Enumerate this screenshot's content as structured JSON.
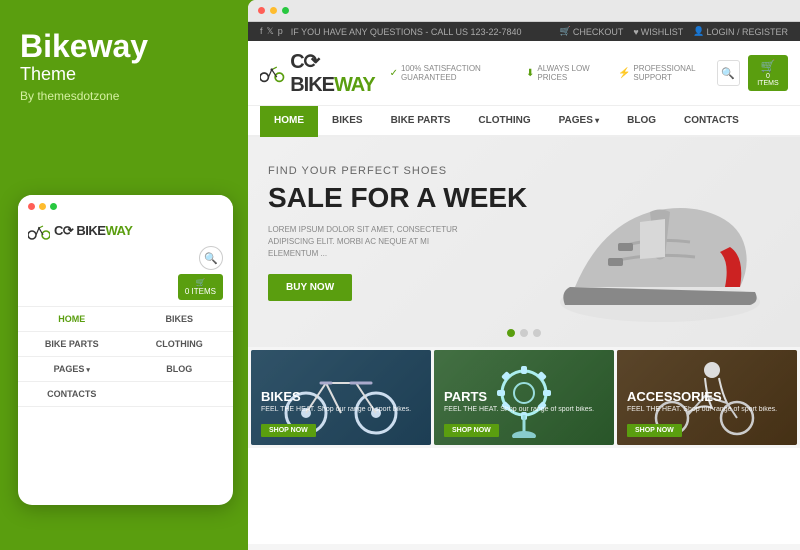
{
  "leftPanel": {
    "brandTitle": "Bikeway",
    "brandSubtitle": "Theme",
    "brandBy": "By themesdotzone"
  },
  "mobileMockup": {
    "dots": [
      "red",
      "yellow",
      "green"
    ],
    "logo": {
      "textBike": "C",
      "textWay": "BIKEWAY"
    },
    "nav": [
      {
        "label": "HOME",
        "active": true,
        "hasArrow": false
      },
      {
        "label": "BIKES",
        "active": false,
        "hasArrow": false
      },
      {
        "label": "BIKE PARTS",
        "active": false,
        "hasArrow": false
      },
      {
        "label": "CLOTHING",
        "active": false,
        "hasArrow": false
      },
      {
        "label": "PAGES",
        "active": false,
        "hasArrow": true
      },
      {
        "label": "BLOG",
        "active": false,
        "hasArrow": false
      },
      {
        "label": "CONTACTS",
        "active": false,
        "hasArrow": false
      }
    ],
    "cartLabel": "0 ITEMS"
  },
  "website": {
    "topbar": {
      "message": "IF YOU HAVE ANY QUESTIONS - CALL US 123-22-7840",
      "links": [
        "CHECKOUT",
        "WISHLIST",
        "LOGIN / REGISTER"
      ]
    },
    "header": {
      "logoBike": "C",
      "logoWay": "BIKEWAY",
      "features": [
        {
          "icon": "✓",
          "text": "100% SATISFACTION GUARANTEED"
        },
        {
          "icon": "↓",
          "text": "ALWAYS LOW PRICES"
        },
        {
          "icon": "⚡",
          "text": "PROFESSIONAL SUPPORT"
        }
      ],
      "cartLabel": "0 ITEMS"
    },
    "nav": [
      {
        "label": "HOME",
        "active": true
      },
      {
        "label": "BIKES",
        "active": false
      },
      {
        "label": "BIKE PARTS",
        "active": false
      },
      {
        "label": "CLOTHING",
        "active": false
      },
      {
        "label": "PAGES",
        "active": false,
        "hasArrow": true
      },
      {
        "label": "BLOG",
        "active": false
      },
      {
        "label": "CONTACTS",
        "active": false
      }
    ],
    "hero": {
      "subtitle": "FIND YOUR PERFECT SHOES",
      "title": "SALE FOR A WEEK",
      "description": "LOREM IPSUM DOLOR SIT AMET, CONSECTETUR ADIPISCING ELIT. MORBI AC NEQUE AT MI ELEMENTUM ...",
      "buttonLabel": "BUY NOW"
    },
    "categories": [
      {
        "title": "BIKES",
        "subtitle": "FEEL THE HEAT. Shop our range of sport bikes.",
        "shopLabel": "SHOP NOW",
        "colorClass": "card-bikes-bg"
      },
      {
        "title": "PARTS",
        "subtitle": "FEEL THE HEAT. Shop our range of sport bikes.",
        "shopLabel": "SHOP NOW",
        "colorClass": "card-parts-bg"
      },
      {
        "title": "ACCESSORIES",
        "subtitle": "FEEL THE HEAT. Shop our range of sport bikes.",
        "shopLabel": "SHOP NOW",
        "colorClass": "card-accessories-bg"
      }
    ]
  },
  "colors": {
    "green": "#5a9e0f",
    "dark": "#333",
    "light": "#f5f5f5"
  }
}
